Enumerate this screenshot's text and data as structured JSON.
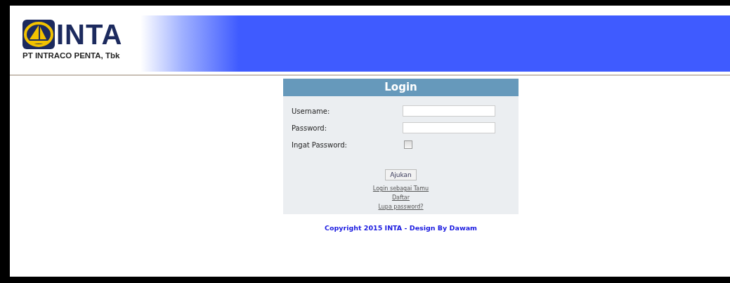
{
  "header": {
    "logo_text": "INTA",
    "company": "PT INTRACO PENTA, Tbk"
  },
  "login": {
    "title": "Login",
    "fields": [
      {
        "label": "Username:",
        "kind": "text"
      },
      {
        "label": "Password:",
        "kind": "password"
      },
      {
        "label": "Ingat Password:",
        "kind": "checkbox",
        "checked": false
      }
    ],
    "submit": "Ajukan",
    "links": [
      "Login sebagai Tamu",
      "Daftar",
      "Lupa password?"
    ]
  },
  "footer": "Copyright 2015 INTA - Design By Dawam"
}
